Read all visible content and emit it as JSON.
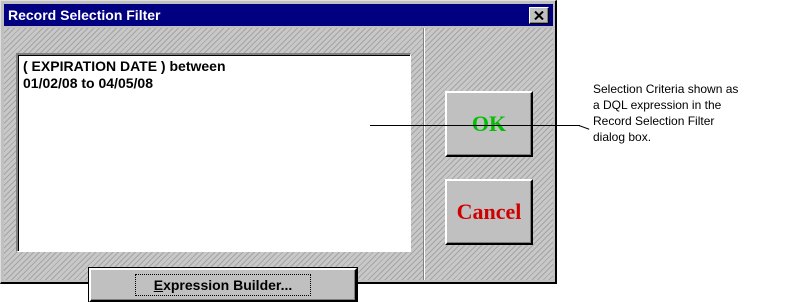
{
  "window": {
    "title": "Record Selection Filter",
    "close_glyph": "×",
    "close_icon": "close-icon"
  },
  "expression": {
    "text": "( EXPIRATION DATE ) between\n01/02/08 to 04/05/08"
  },
  "buttons": {
    "expression_builder": {
      "mnemonic": "E",
      "rest": "xpression Builder..."
    },
    "ok": "OK",
    "cancel": "Cancel"
  },
  "callout": {
    "text": "Selection Criteria shown as\na DQL expression in the\nRecord Selection Filter\ndialog box."
  },
  "colors": {
    "titlebar": "#000080",
    "ok_text": "#00c000",
    "cancel_text": "#d00000"
  }
}
